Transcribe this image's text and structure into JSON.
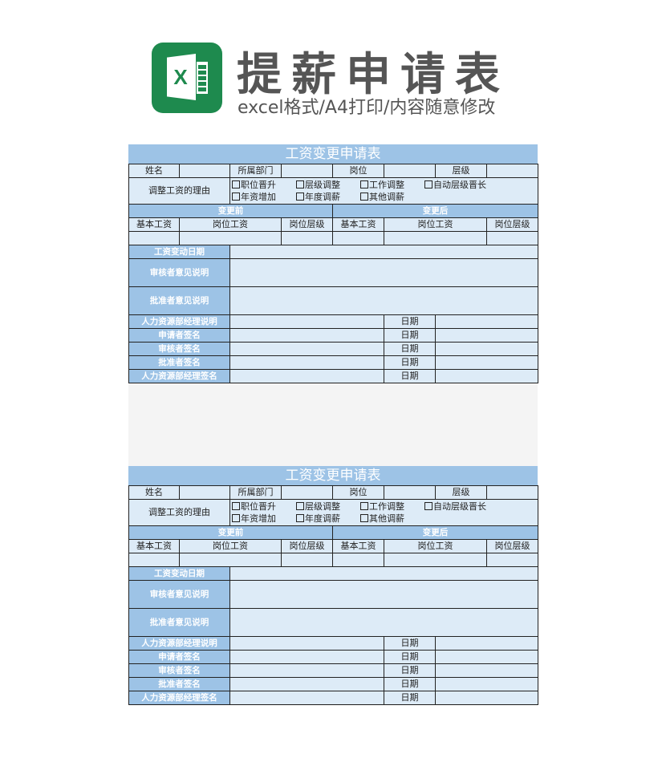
{
  "header": {
    "app_icon": "excel-icon",
    "app_icon_letter": "X",
    "title": "提薪申请表",
    "subtitle": "excel格式/A4打印/内容随意修改"
  },
  "colors": {
    "accent": "#9dc3e6",
    "cell_bg": "#ddebf7",
    "brand_green": "#1e8a4e",
    "title_gray": "#555555"
  },
  "forms": [
    {
      "title": "工资变更申请表",
      "row1": {
        "name_label": "姓名",
        "dept_label": "所属部门",
        "post_label": "岗位",
        "level_label": "层级"
      },
      "reason_label": "调整工资的理由",
      "reasons": [
        "职位晋升",
        "层级调整",
        "工作调整",
        "自动层级晋长",
        "年资增加",
        "年度调薪",
        "其他调薪"
      ],
      "before_label": "变更前",
      "after_label": "变更后",
      "cols": [
        "基本工资",
        "岗位工资",
        "岗位层级",
        "基本工资",
        "岗位工资",
        "岗位层级"
      ],
      "change_date_label": "工资变动日期",
      "reviewer_opinion_label": "审核者意见说明",
      "approver_opinion_label": "批准者意见说明",
      "sign_rows": [
        "人力资源部经理说明",
        "申请者签名",
        "审核者签名",
        "批准者签名",
        "人力资源部经理签名"
      ],
      "date_label": "日期"
    },
    {
      "title": "工资变更申请表",
      "row1": {
        "name_label": "姓名",
        "dept_label": "所属部门",
        "post_label": "岗位",
        "level_label": "层级"
      },
      "reason_label": "调整工资的理由",
      "reasons": [
        "职位晋升",
        "层级调整",
        "工作调整",
        "自动层级晋长",
        "年资增加",
        "年度调薪",
        "其他调薪"
      ],
      "before_label": "变更前",
      "after_label": "变更后",
      "cols": [
        "基本工资",
        "岗位工资",
        "岗位层级",
        "基本工资",
        "岗位工资",
        "岗位层级"
      ],
      "change_date_label": "工资变动日期",
      "reviewer_opinion_label": "审核者意见说明",
      "approver_opinion_label": "批准者意见说明",
      "sign_rows": [
        "人力资源部经理说明",
        "申请者签名",
        "审核者签名",
        "批准者签名",
        "人力资源部经理签名"
      ],
      "date_label": "日期"
    }
  ]
}
